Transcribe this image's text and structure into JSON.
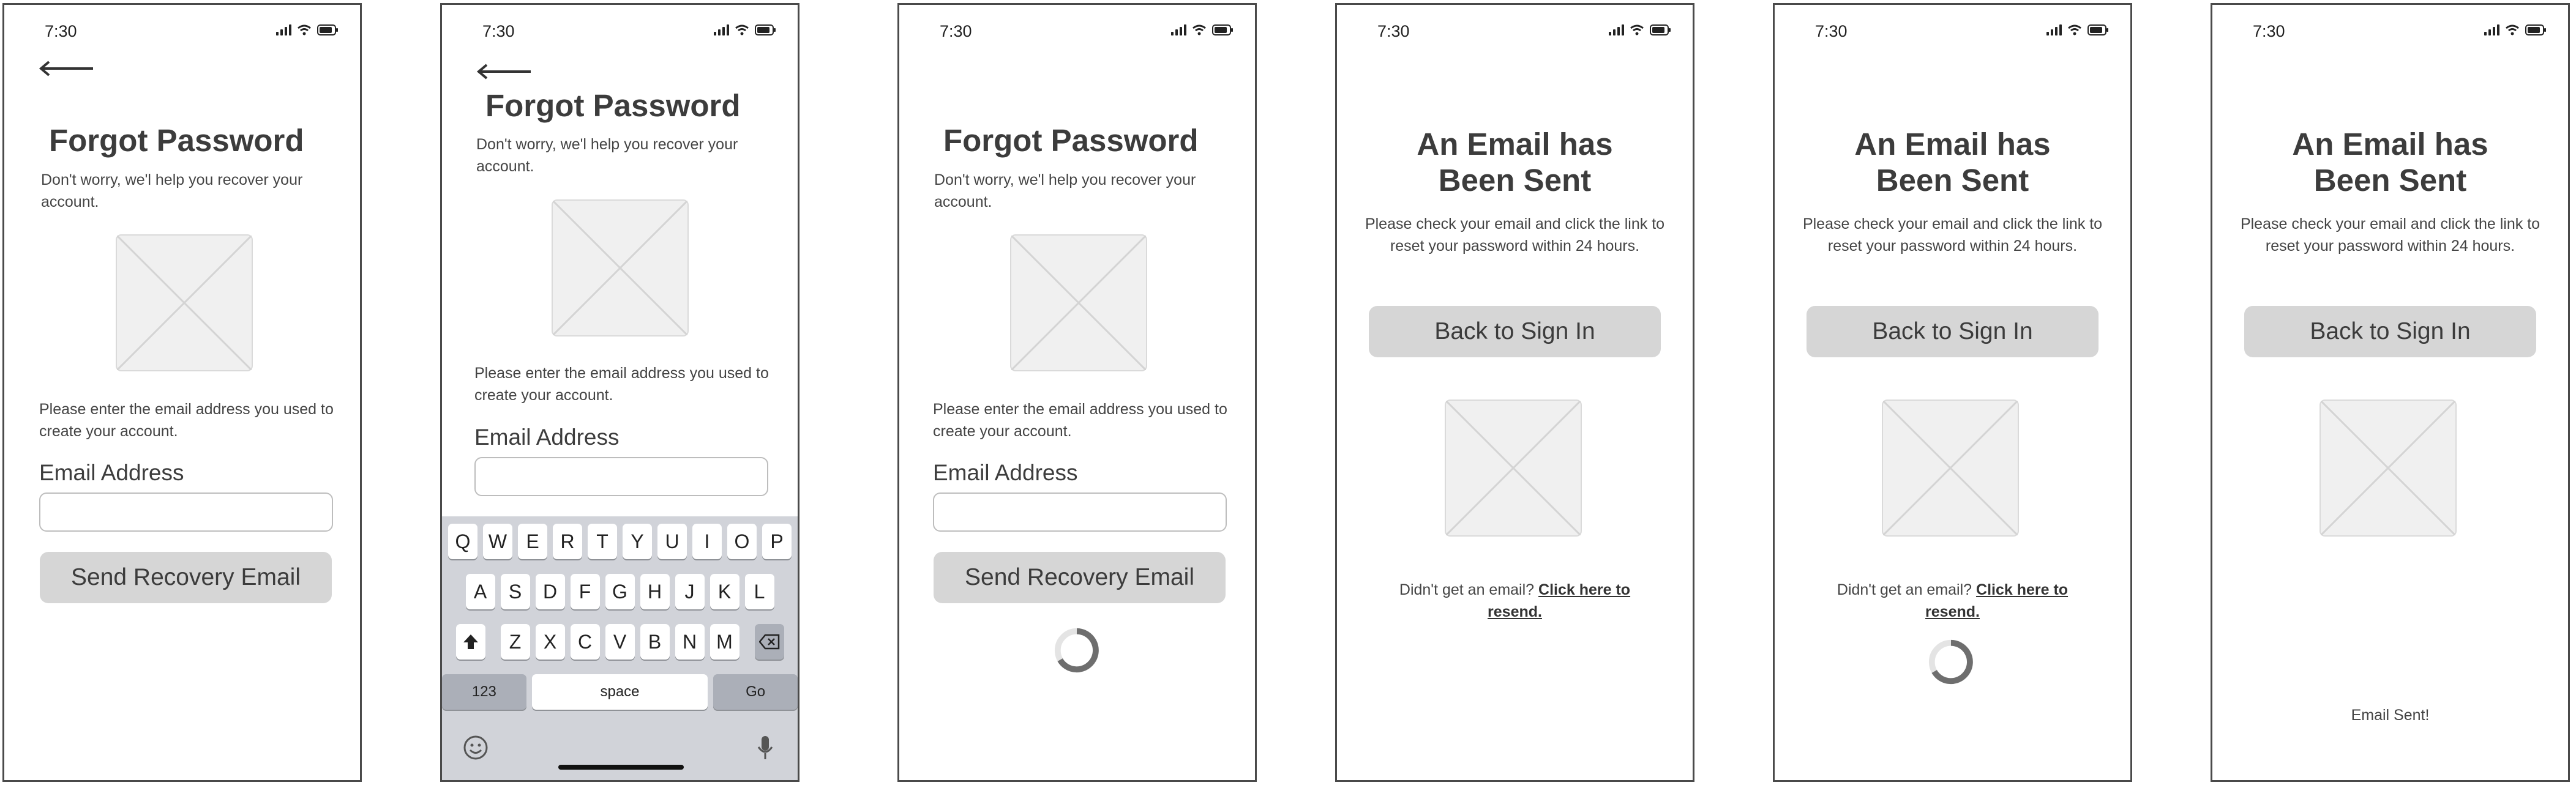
{
  "status": {
    "time": "7:30"
  },
  "forgot": {
    "title": "Forgot Password",
    "subtitle": "Don't worry, we'l help you recover your account.",
    "instructions": "Please enter the email address you used to create your account.",
    "email_label": "Email Address",
    "email_value": "",
    "send_button": "Send Recovery Email"
  },
  "sent": {
    "title": "An Email has Been Sent",
    "message": "Please check your email and click the link to reset your password within 24 hours.",
    "back_button": "Back to Sign In",
    "didnt_get": "Didn't get an email?",
    "resend_link": "Click here to resend.",
    "confirmation": "Email Sent!"
  },
  "keyboard": {
    "row1": [
      "Q",
      "W",
      "E",
      "R",
      "T",
      "Y",
      "U",
      "I",
      "O",
      "P"
    ],
    "row2": [
      "A",
      "S",
      "D",
      "F",
      "G",
      "H",
      "J",
      "K",
      "L"
    ],
    "row3": [
      "Z",
      "X",
      "C",
      "V",
      "B",
      "N",
      "M"
    ],
    "numbers_key": "123",
    "space_key": "space",
    "go_key": "Go"
  },
  "icons": {
    "back": "arrow-left-icon",
    "signal": "cellular-signal-icon",
    "wifi": "wifi-icon",
    "battery": "battery-icon",
    "placeholder": "image-placeholder-icon",
    "spinner": "loading-spinner-icon",
    "shift": "shift-icon",
    "delete": "backspace-icon",
    "emoji": "emoji-icon",
    "mic": "microphone-icon"
  },
  "colors": {
    "button_bg": "#d6d6d6",
    "keyboard_bg": "#d1d3d9",
    "phone_border": "#4a4a4a"
  }
}
